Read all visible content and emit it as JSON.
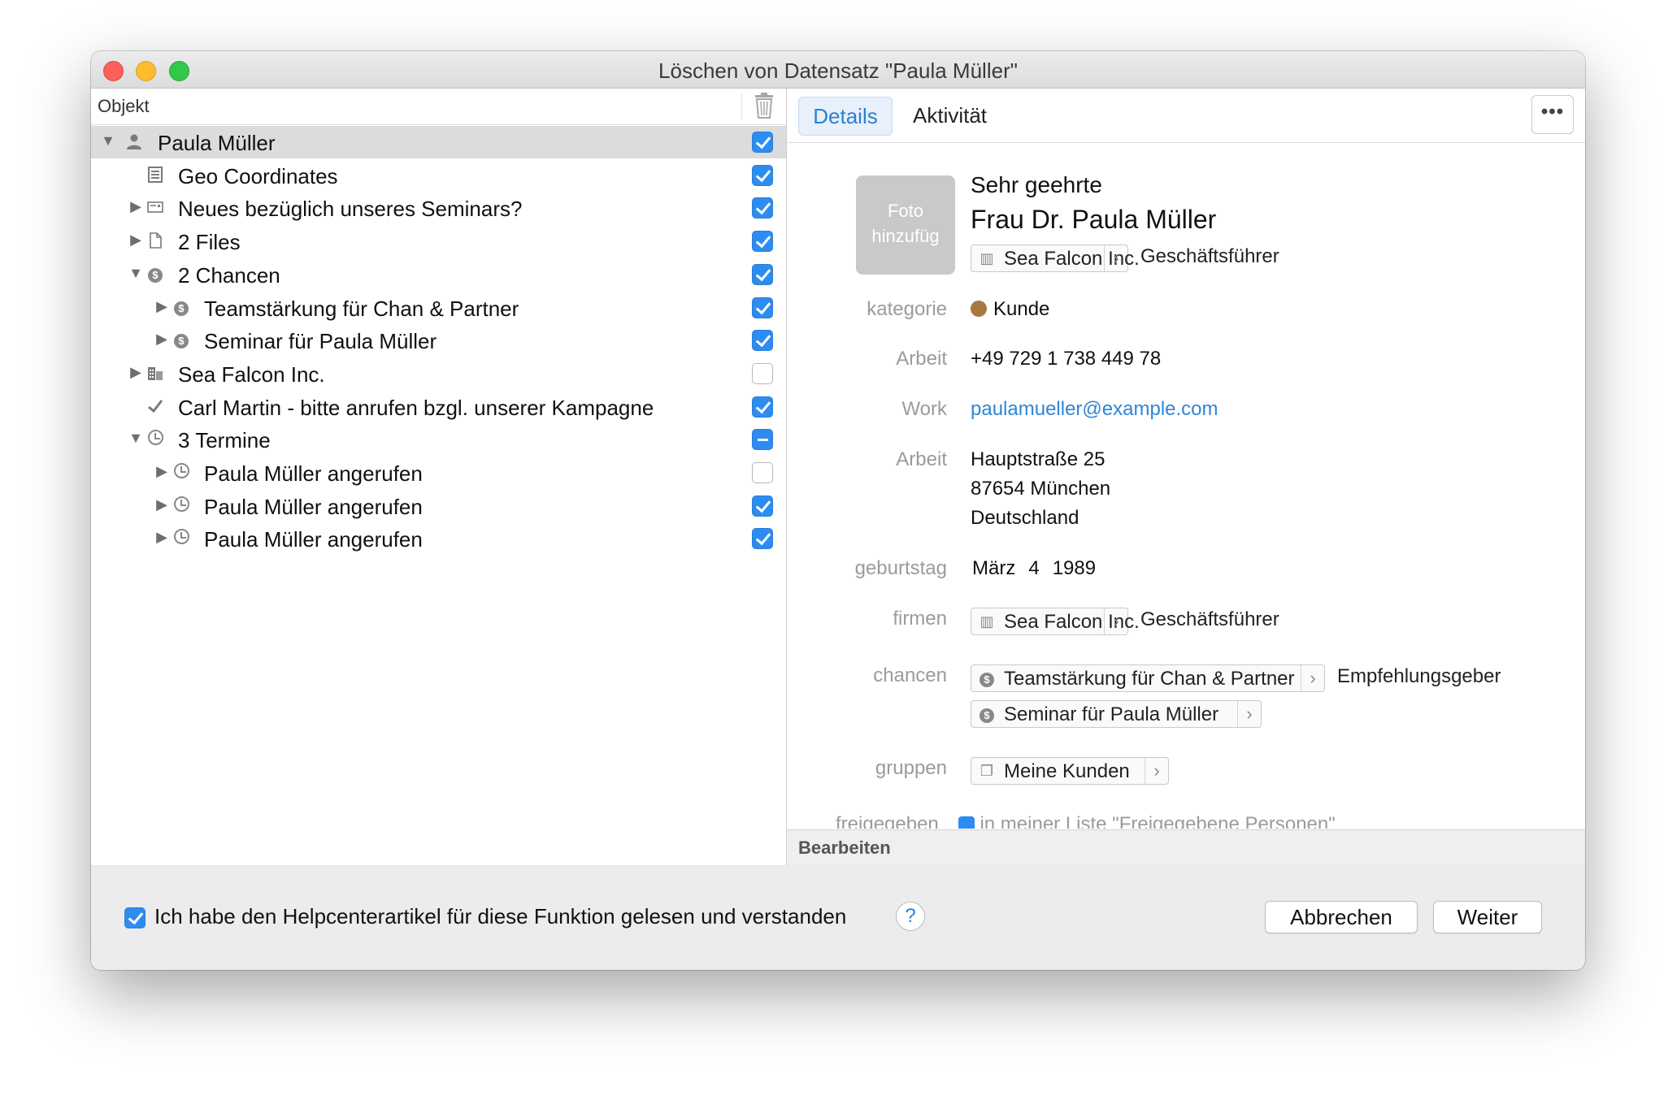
{
  "window": {
    "title": "Löschen von Datensatz \"Paula Müller\""
  },
  "left": {
    "column_header": "Objekt",
    "rows": [
      {
        "label": "Paula Müller",
        "icon": "person-icon",
        "expander": "open",
        "checked": "on",
        "level": 0
      },
      {
        "label": "Geo Coordinates",
        "icon": "note-icon",
        "expander": "none",
        "checked": "on",
        "level": 1
      },
      {
        "label": "Neues bezüglich unseres Seminars?",
        "icon": "mail-icon",
        "expander": "closed",
        "checked": "on",
        "level": 1
      },
      {
        "label": "2 Files",
        "icon": "file-icon",
        "expander": "closed",
        "checked": "on",
        "level": 1
      },
      {
        "label": "2 Chancen",
        "icon": "dollar-icon",
        "expander": "open",
        "checked": "on",
        "level": 1
      },
      {
        "label": "Teamstärkung für Chan & Partner",
        "icon": "dollar-icon",
        "expander": "closed",
        "checked": "on",
        "level": 2
      },
      {
        "label": "Seminar für Paula Müller",
        "icon": "dollar-icon",
        "expander": "closed",
        "checked": "on",
        "level": 2
      },
      {
        "label": "Sea Falcon Inc.",
        "icon": "building-icon",
        "expander": "closed",
        "checked": "off",
        "level": 1
      },
      {
        "label": "Carl Martin - bitte anrufen bzgl. unserer Kampagne",
        "icon": "checkmark-icon",
        "expander": "none",
        "checked": "on",
        "level": 1
      },
      {
        "label": "3 Termine",
        "icon": "clock-icon",
        "expander": "open",
        "checked": "mixed",
        "level": 1
      },
      {
        "label": "Paula Müller angerufen",
        "icon": "clock-icon",
        "expander": "closed",
        "checked": "off",
        "level": 2
      },
      {
        "label": "Paula Müller angerufen",
        "icon": "clock-icon",
        "expander": "closed",
        "checked": "on",
        "level": 2
      },
      {
        "label": "Paula Müller angerufen",
        "icon": "clock-icon",
        "expander": "closed",
        "checked": "on",
        "level": 2
      }
    ]
  },
  "right": {
    "tabs": {
      "details": "Details",
      "activity": "Aktivität"
    },
    "more": "•••",
    "photo": {
      "line1": "Foto",
      "line2": "hinzufüg"
    },
    "salutation": "Sehr geehrte",
    "name": "Frau Dr. Paula Müller",
    "company_chip": "Sea Falcon Inc.",
    "company_role": "Geschäftsführer",
    "fields": {
      "kategorie": {
        "label": "kategorie",
        "value": "Kunde"
      },
      "phone": {
        "label": "Arbeit",
        "value": "+49 729 1 738 449 78"
      },
      "email": {
        "label": "Work",
        "value": "paulamueller@example.com"
      },
      "address": {
        "label": "Arbeit",
        "line1": "Hauptstraße 25",
        "line2": "87654 München",
        "line3": "Deutschland"
      },
      "birthday": {
        "label": "geburtstag",
        "month": "März",
        "day": "4",
        "year": "1989"
      },
      "firmen": {
        "label": "firmen",
        "chip": "Sea Falcon Inc.",
        "role": "Geschäftsführer"
      },
      "chancen": {
        "label": "chancen",
        "chip1": "Teamstärkung für Chan & Partner",
        "role1": "Empfehlungsgeber",
        "chip2": "Seminar für Paula Müller"
      },
      "gruppen": {
        "label": "gruppen",
        "chip": "Meine Kunden"
      },
      "freigegeben": {
        "label": "freigegeben",
        "value": "in meiner Liste \"Freigegebene Personen\""
      }
    },
    "edit_label": "Bearbeiten"
  },
  "footer": {
    "agree_text": "Ich habe den Helpcenterartikel für diese Funktion gelesen und verstanden",
    "help": "?",
    "cancel": "Abbrechen",
    "next": "Weiter"
  },
  "colors": {
    "accent": "#2d8cf0",
    "link": "#2f86d6",
    "kunde_dot": "#a9783f"
  }
}
